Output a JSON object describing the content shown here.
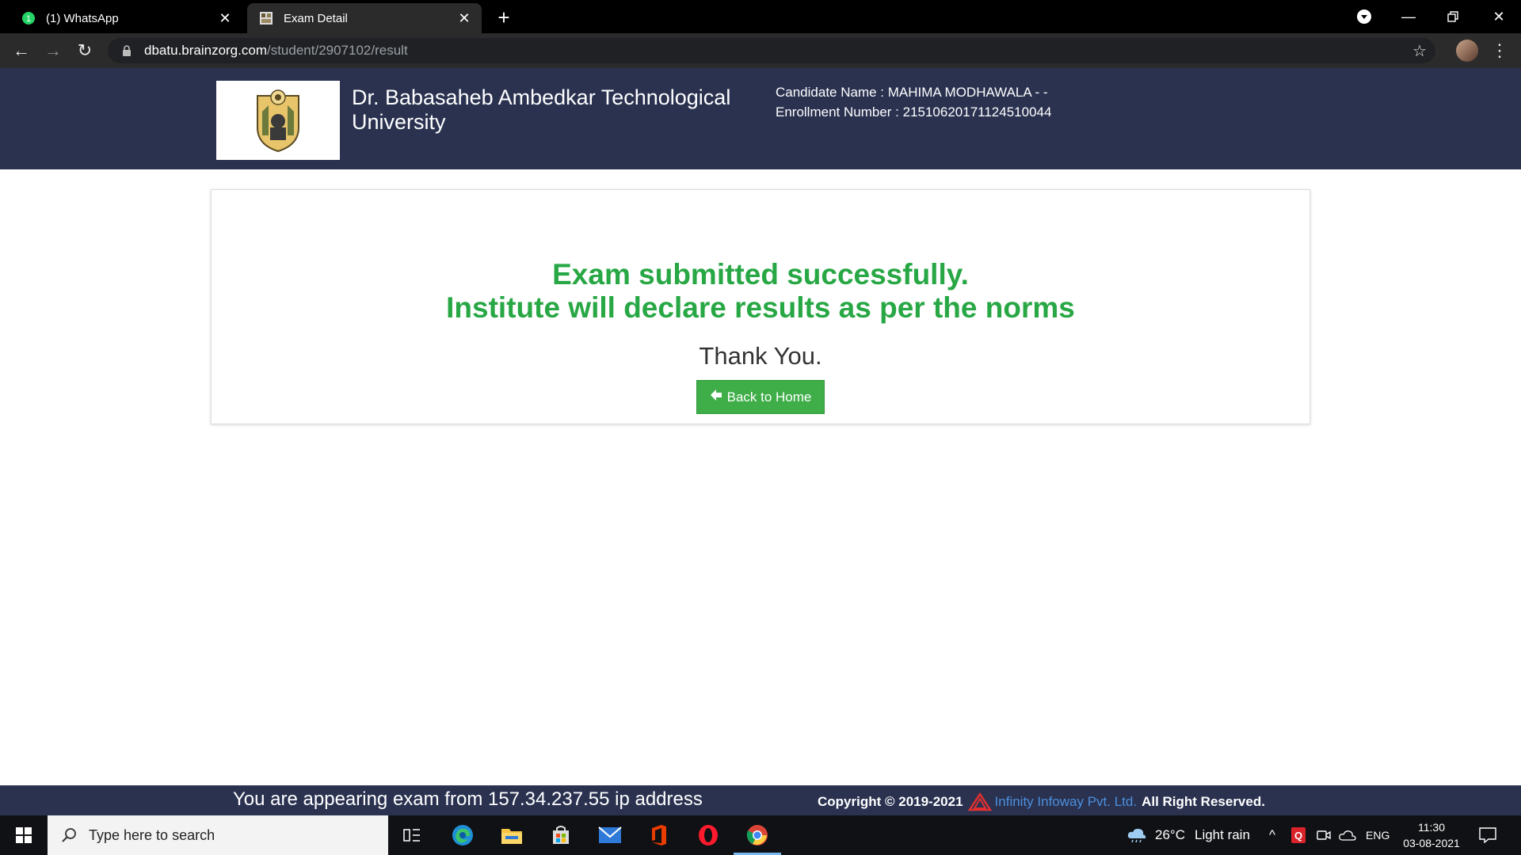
{
  "browser": {
    "tabs": [
      {
        "title": "(1) WhatsApp",
        "icon": "whatsapp-icon"
      },
      {
        "title": "Exam Detail",
        "icon": "university-favicon"
      }
    ],
    "url_host": "dbatu.brainzorg.com",
    "url_path": "/student/2907102/result"
  },
  "header": {
    "university_name": "Dr. Babasaheb Ambedkar Technological University",
    "candidate_name_line": "Candidate Name : MAHIMA MODHAWALA - -",
    "enrollment_line": "Enrollment Number : 21510620171124510044"
  },
  "result": {
    "message_line1": "Exam submitted successfully.",
    "message_line2": "Institute will declare results as per the norms",
    "thanks": "Thank You.",
    "home_button": "Back to Home"
  },
  "footer": {
    "ip_message": "You are appearing exam from 157.34.237.55 ip address",
    "copyright": "Copyright © 2019-2021",
    "company": "Infinity Infoway Pvt. Ltd.",
    "rights": "All Right Reserved."
  },
  "taskbar": {
    "search_placeholder": "Type here to search",
    "weather_temp": "26°C",
    "weather_desc": "Light rain",
    "language": "ENG",
    "time": "11:30",
    "date": "03-08-2021"
  },
  "colors": {
    "header_bg": "#2a3250",
    "success_green": "#28a745",
    "button_green": "#3fae49",
    "link_blue": "#4d8fdc"
  }
}
